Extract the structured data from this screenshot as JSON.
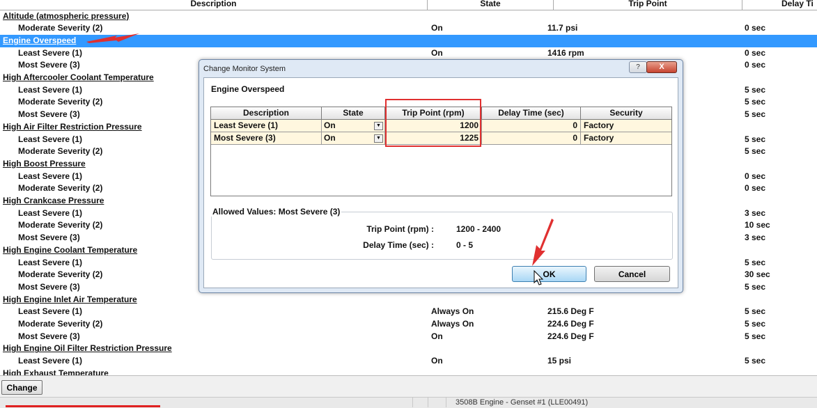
{
  "columns": [
    "Description",
    "State",
    "Trip Point",
    "Delay Ti"
  ],
  "rows": [
    {
      "type": "category",
      "label": "Altitude (atmospheric pressure)"
    },
    {
      "type": "item",
      "label": "Moderate Severity (2)",
      "state": "On",
      "trip": "11.7 psi",
      "delay": "0 sec"
    },
    {
      "type": "category",
      "label": "Engine Overspeed",
      "selected": true
    },
    {
      "type": "item",
      "label": "Least Severe (1)",
      "state": "On",
      "trip": "1416 rpm",
      "delay": "0 sec"
    },
    {
      "type": "item",
      "label": "Most Severe (3)",
      "state": "",
      "trip": "",
      "delay": "0 sec"
    },
    {
      "type": "category",
      "label": "High Aftercooler Coolant Temperature"
    },
    {
      "type": "item",
      "label": "Least Severe (1)",
      "state": "",
      "trip": "",
      "delay": "5 sec"
    },
    {
      "type": "item",
      "label": "Moderate Severity (2)",
      "state": "",
      "trip": "",
      "delay": "5 sec"
    },
    {
      "type": "item",
      "label": "Most Severe (3)",
      "state": "",
      "trip": "",
      "delay": "5 sec"
    },
    {
      "type": "category",
      "label": "High Air Filter Restriction Pressure"
    },
    {
      "type": "item",
      "label": "Least Severe (1)",
      "state": "",
      "trip": "",
      "delay": "5 sec"
    },
    {
      "type": "item",
      "label": "Moderate Severity (2)",
      "state": "",
      "trip": "",
      "delay": "5 sec"
    },
    {
      "type": "category",
      "label": "High Boost Pressure"
    },
    {
      "type": "item",
      "label": "Least Severe (1)",
      "state": "",
      "trip": "",
      "delay": "0 sec"
    },
    {
      "type": "item",
      "label": "Moderate Severity (2)",
      "state": "",
      "trip": "",
      "delay": "0 sec"
    },
    {
      "type": "category",
      "label": "High Crankcase Pressure"
    },
    {
      "type": "item",
      "label": "Least Severe (1)",
      "state": "",
      "trip": "",
      "delay": "3 sec"
    },
    {
      "type": "item",
      "label": "Moderate Severity (2)",
      "state": "",
      "trip": "",
      "delay": "10 sec"
    },
    {
      "type": "item",
      "label": "Most Severe (3)",
      "state": "",
      "trip": "",
      "delay": "3 sec"
    },
    {
      "type": "category",
      "label": "High Engine Coolant Temperature"
    },
    {
      "type": "item",
      "label": "Least Severe (1)",
      "state": "",
      "trip": "",
      "delay": "5 sec"
    },
    {
      "type": "item",
      "label": "Moderate Severity (2)",
      "state": "",
      "trip": "",
      "delay": "30 sec"
    },
    {
      "type": "item",
      "label": "Most Severe (3)",
      "state": "",
      "trip": "",
      "delay": "5 sec"
    },
    {
      "type": "category",
      "label": "High Engine Inlet Air Temperature"
    },
    {
      "type": "item",
      "label": "Least Severe (1)",
      "state": "Always On",
      "trip": "215.6 Deg F",
      "delay": "5 sec"
    },
    {
      "type": "item",
      "label": "Moderate Severity (2)",
      "state": "Always On",
      "trip": "224.6 Deg F",
      "delay": "5 sec"
    },
    {
      "type": "item",
      "label": "Most Severe (3)",
      "state": "On",
      "trip": "224.6 Deg F",
      "delay": "5 sec"
    },
    {
      "type": "category",
      "label": "High Engine Oil Filter Restriction Pressure"
    },
    {
      "type": "item",
      "label": "Least Severe (1)",
      "state": "On",
      "trip": "15 psi",
      "delay": "5 sec"
    },
    {
      "type": "category",
      "label": "High Exhaust Temperature"
    }
  ],
  "toolbar": {
    "change_label": "Change"
  },
  "status": {
    "text": "3508B Engine - Genset #1 (LLE00491)"
  },
  "dialog": {
    "title": "Change Monitor System",
    "help_label": "?",
    "close_label": "X",
    "heading": "Engine Overspeed",
    "grid_headers": [
      "Description",
      "State",
      "Trip Point (rpm)",
      "Delay Time (sec)",
      "Security"
    ],
    "grid_rows": [
      {
        "description": "Least Severe (1)",
        "state": "On",
        "trip": "1200",
        "delay": "0",
        "security": "Factory"
      },
      {
        "description": "Most Severe (3)",
        "state": "On",
        "trip": "1225",
        "delay": "0",
        "security": "Factory"
      }
    ],
    "allowed_title": "Allowed Values: Most Severe (3)",
    "trip_label": "Trip Point (rpm) :",
    "trip_range": "1200 - 2400",
    "delay_label": "Delay Time (sec) :",
    "delay_range": "0 - 5",
    "ok_label": "OK",
    "cancel_label": "Cancel"
  },
  "colors": {
    "selection": "#3399ff",
    "annotation": "#e03030",
    "dialog_frame": "#dfe9f5",
    "grid_row": "#fff7df"
  },
  "icons": [
    "dropdown-arrow-icon",
    "help-icon",
    "close-icon",
    "mouse-cursor-icon",
    "red-annotation-arrow-icon"
  ]
}
